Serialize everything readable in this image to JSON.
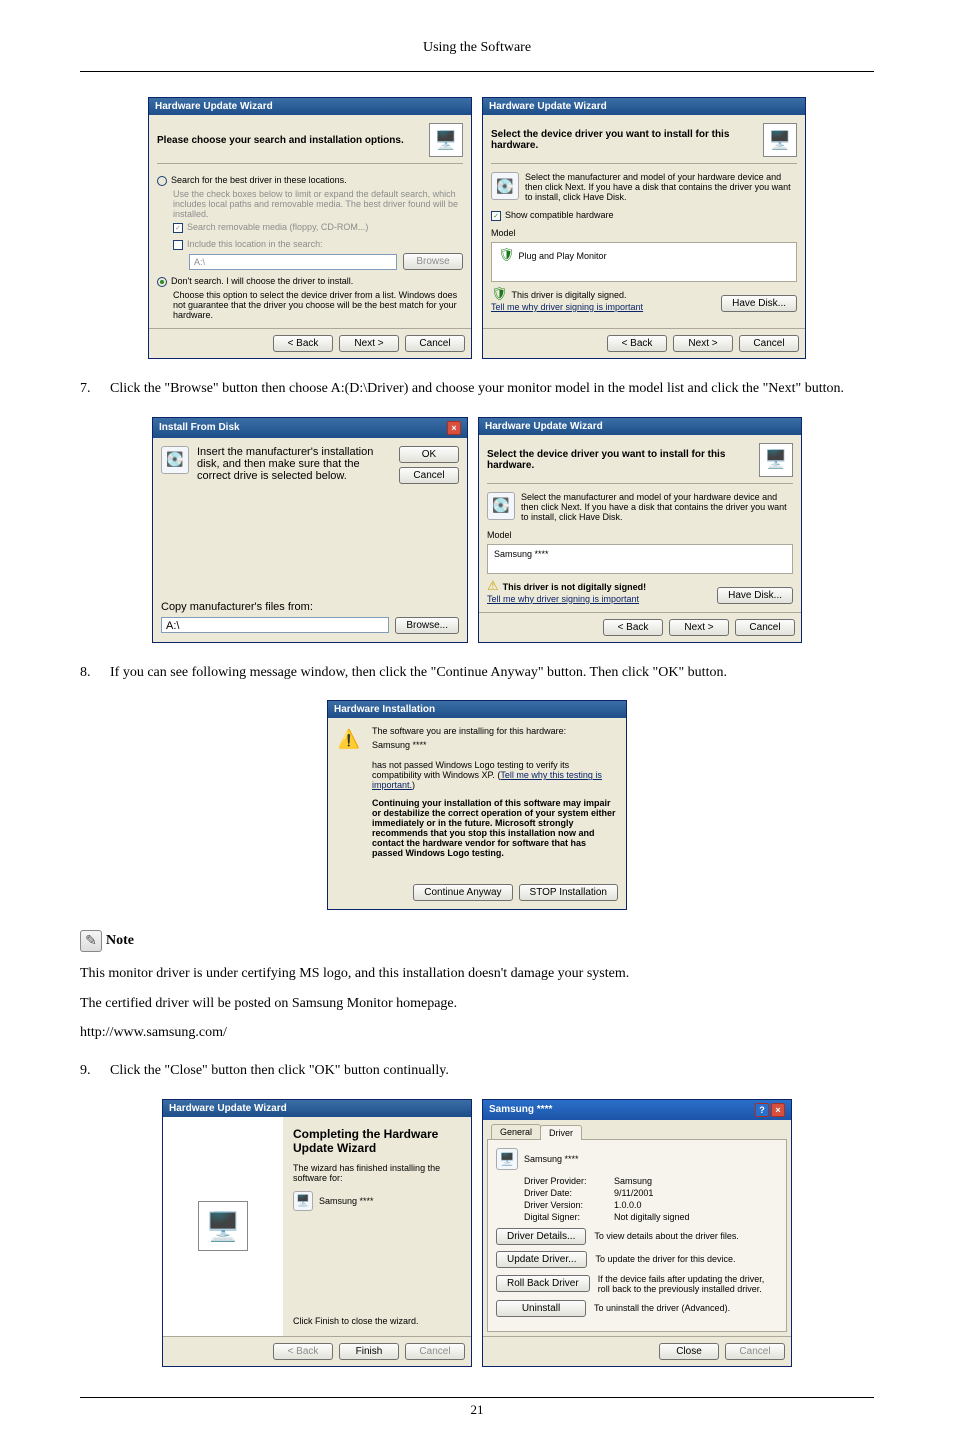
{
  "header": {
    "title": "Using the Software"
  },
  "step7": {
    "num": "7.",
    "text": "Click the \"Browse\" button then choose A:(D:\\Driver) and choose your monitor model in the model list and click the \"Next\" button."
  },
  "step8": {
    "num": "8.",
    "text": "If you can see following message window, then click the \"Continue Anyway\" button. Then click \"OK\" button."
  },
  "step9": {
    "num": "9.",
    "text": "Click the \"Close\" button then click \"OK\" button continually."
  },
  "note": {
    "label": "Note",
    "p1": "This monitor driver is under certifying MS logo, and this installation doesn't damage your system.",
    "p2": "The certified driver will be posted on Samsung Monitor homepage.",
    "p3": "http://www.samsung.com/"
  },
  "dlg_search": {
    "title": "Hardware Update Wizard",
    "heading": "Please choose your search and installation options.",
    "r1": "Search for the best driver in these locations.",
    "r1_sub": "Use the check boxes below to limit or expand the default search, which includes local paths and removable media. The best driver found will be installed.",
    "c1": "Search removable media (floppy, CD-ROM...)",
    "c2": "Include this location in the search:",
    "path": "A:\\",
    "browse": "Browse",
    "r2": "Don't search. I will choose the driver to install.",
    "r2_sub": "Choose this option to select the device driver from a list. Windows does not guarantee that the driver you choose will be the best match for your hardware.",
    "back": "< Back",
    "next": "Next >",
    "cancel": "Cancel"
  },
  "dlg_select1": {
    "title": "Hardware Update Wizard",
    "heading": "Select the device driver you want to install for this hardware.",
    "sub": "Select the manufacturer and model of your hardware device and then click Next. If you have a disk that contains the driver you want to install, click Have Disk.",
    "show": "Show compatible hardware",
    "model_lbl": "Model",
    "model": "Plug and Play Monitor",
    "signed": "This driver is digitally signed.",
    "tell": "Tell me why driver signing is important",
    "have": "Have Disk...",
    "back": "< Back",
    "next": "Next >",
    "cancel": "Cancel"
  },
  "dlg_install_from_disk": {
    "title": "Install From Disk",
    "msg": "Insert the manufacturer's installation disk, and then make sure that the correct drive is selected below.",
    "ok": "OK",
    "cancel": "Cancel",
    "copy": "Copy manufacturer's files from:",
    "path": "A:\\",
    "browse": "Browse..."
  },
  "dlg_select2": {
    "title": "Hardware Update Wizard",
    "heading": "Select the device driver you want to install for this hardware.",
    "sub": "Select the manufacturer and model of your hardware device and then click Next. If you have a disk that contains the driver you want to install, click Have Disk.",
    "model_lbl": "Model",
    "model": "Samsung ****",
    "unsigned": "This driver is not digitally signed!",
    "tell": "Tell me why driver signing is important",
    "have": "Have Disk...",
    "back": "< Back",
    "next": "Next >",
    "cancel": "Cancel"
  },
  "dlg_hwinst": {
    "title": "Hardware Installation",
    "l1": "The software you are installing for this hardware:",
    "l2": "Samsung ****",
    "l3": "has not passed Windows Logo testing to verify its compatibility with Windows XP. (",
    "l3_link": "Tell me why this testing is important.",
    "l3_end": ")",
    "bold": "Continuing your installation of this software may impair or destabilize the correct operation of your system either immediately or in the future. Microsoft strongly recommends that you stop this installation now and contact the hardware vendor for software that has passed Windows Logo testing.",
    "cont": "Continue Anyway",
    "stop": "STOP Installation"
  },
  "dlg_complete": {
    "title": "Hardware Update Wizard",
    "h": "Completing the Hardware Update Wizard",
    "sub1": "The wizard has finished installing the software for:",
    "dev": "Samsung ****",
    "sub2": "Click Finish to close the wizard.",
    "back": "< Back",
    "finish": "Finish",
    "cancel": "Cancel"
  },
  "dlg_props": {
    "title": "Samsung ****",
    "tab_general": "General",
    "tab_driver": "Driver",
    "dev": "Samsung ****",
    "provider_k": "Driver Provider:",
    "provider_v": "Samsung",
    "date_k": "Driver Date:",
    "date_v": "9/11/2001",
    "ver_k": "Driver Version:",
    "ver_v": "1.0.0.0",
    "sign_k": "Digital Signer:",
    "sign_v": "Not digitally signed",
    "b1": "Driver Details...",
    "d1": "To view details about the driver files.",
    "b2": "Update Driver...",
    "d2": "To update the driver for this device.",
    "b3": "Roll Back Driver",
    "d3": "If the device fails after updating the driver, roll back to the previously installed driver.",
    "b4": "Uninstall",
    "d4": "To uninstall the driver (Advanced).",
    "close": "Close",
    "cancel": "Cancel"
  },
  "footer": {
    "page": "21"
  }
}
